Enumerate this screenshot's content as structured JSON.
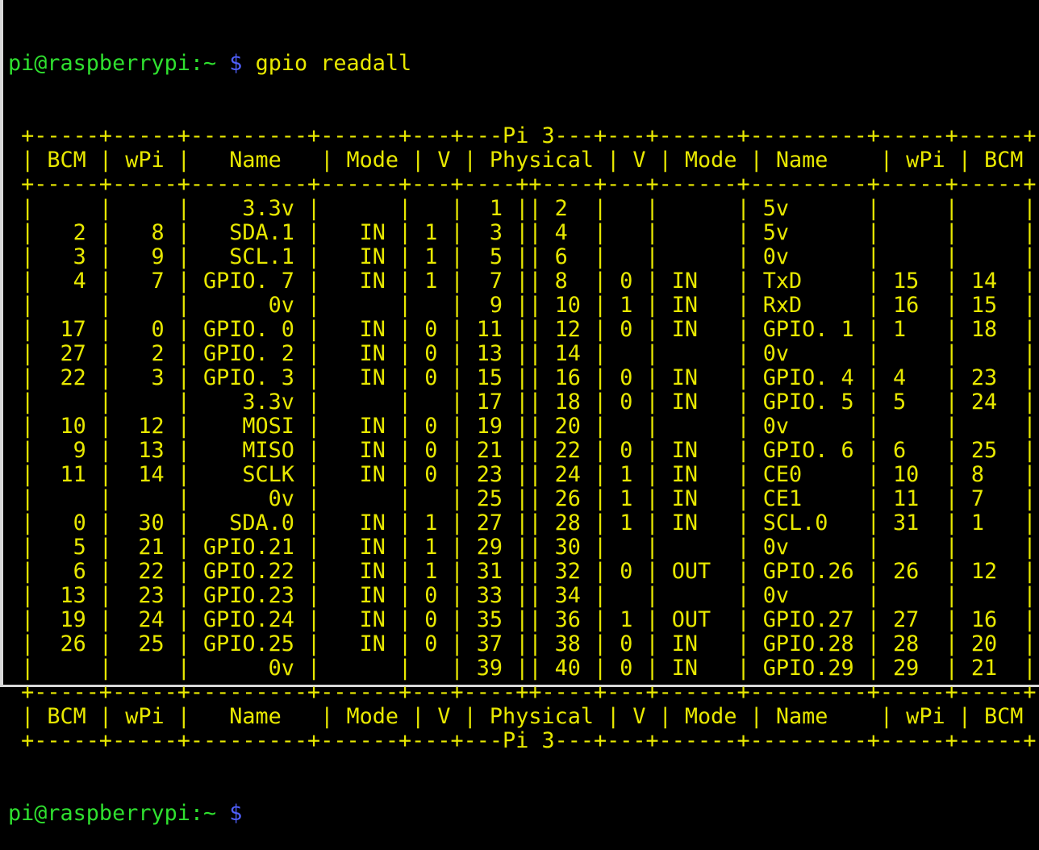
{
  "prompt": {
    "user_host": "pi@raspberrypi",
    "path": ":~",
    "symbol": "$"
  },
  "command": "gpio readall",
  "board_label": "Pi 3",
  "header": [
    "BCM",
    "wPi",
    "Name",
    "Mode",
    "V",
    "Physical",
    "V",
    "Mode",
    "Name",
    "wPi",
    "BCM"
  ],
  "rows": [
    {
      "bcm_l": "",
      "wpi_l": "",
      "name_l": "3.3v",
      "mode_l": "",
      "v_l": "",
      "phys_l": "1",
      "phys_r": "2",
      "v_r": "",
      "mode_r": "",
      "name_r": "5v",
      "wpi_r": "",
      "bcm_r": ""
    },
    {
      "bcm_l": "2",
      "wpi_l": "8",
      "name_l": "SDA.1",
      "mode_l": "IN",
      "v_l": "1",
      "phys_l": "3",
      "phys_r": "4",
      "v_r": "",
      "mode_r": "",
      "name_r": "5v",
      "wpi_r": "",
      "bcm_r": ""
    },
    {
      "bcm_l": "3",
      "wpi_l": "9",
      "name_l": "SCL.1",
      "mode_l": "IN",
      "v_l": "1",
      "phys_l": "5",
      "phys_r": "6",
      "v_r": "",
      "mode_r": "",
      "name_r": "0v",
      "wpi_r": "",
      "bcm_r": ""
    },
    {
      "bcm_l": "4",
      "wpi_l": "7",
      "name_l": "GPIO. 7",
      "mode_l": "IN",
      "v_l": "1",
      "phys_l": "7",
      "phys_r": "8",
      "v_r": "0",
      "mode_r": "IN",
      "name_r": "TxD",
      "wpi_r": "15",
      "bcm_r": "14"
    },
    {
      "bcm_l": "",
      "wpi_l": "",
      "name_l": "0v",
      "mode_l": "",
      "v_l": "",
      "phys_l": "9",
      "phys_r": "10",
      "v_r": "1",
      "mode_r": "IN",
      "name_r": "RxD",
      "wpi_r": "16",
      "bcm_r": "15"
    },
    {
      "bcm_l": "17",
      "wpi_l": "0",
      "name_l": "GPIO. 0",
      "mode_l": "IN",
      "v_l": "0",
      "phys_l": "11",
      "phys_r": "12",
      "v_r": "0",
      "mode_r": "IN",
      "name_r": "GPIO. 1",
      "wpi_r": "1",
      "bcm_r": "18"
    },
    {
      "bcm_l": "27",
      "wpi_l": "2",
      "name_l": "GPIO. 2",
      "mode_l": "IN",
      "v_l": "0",
      "phys_l": "13",
      "phys_r": "14",
      "v_r": "",
      "mode_r": "",
      "name_r": "0v",
      "wpi_r": "",
      "bcm_r": ""
    },
    {
      "bcm_l": "22",
      "wpi_l": "3",
      "name_l": "GPIO. 3",
      "mode_l": "IN",
      "v_l": "0",
      "phys_l": "15",
      "phys_r": "16",
      "v_r": "0",
      "mode_r": "IN",
      "name_r": "GPIO. 4",
      "wpi_r": "4",
      "bcm_r": "23"
    },
    {
      "bcm_l": "",
      "wpi_l": "",
      "name_l": "3.3v",
      "mode_l": "",
      "v_l": "",
      "phys_l": "17",
      "phys_r": "18",
      "v_r": "0",
      "mode_r": "IN",
      "name_r": "GPIO. 5",
      "wpi_r": "5",
      "bcm_r": "24"
    },
    {
      "bcm_l": "10",
      "wpi_l": "12",
      "name_l": "MOSI",
      "mode_l": "IN",
      "v_l": "0",
      "phys_l": "19",
      "phys_r": "20",
      "v_r": "",
      "mode_r": "",
      "name_r": "0v",
      "wpi_r": "",
      "bcm_r": ""
    },
    {
      "bcm_l": "9",
      "wpi_l": "13",
      "name_l": "MISO",
      "mode_l": "IN",
      "v_l": "0",
      "phys_l": "21",
      "phys_r": "22",
      "v_r": "0",
      "mode_r": "IN",
      "name_r": "GPIO. 6",
      "wpi_r": "6",
      "bcm_r": "25"
    },
    {
      "bcm_l": "11",
      "wpi_l": "14",
      "name_l": "SCLK",
      "mode_l": "IN",
      "v_l": "0",
      "phys_l": "23",
      "phys_r": "24",
      "v_r": "1",
      "mode_r": "IN",
      "name_r": "CE0",
      "wpi_r": "10",
      "bcm_r": "8"
    },
    {
      "bcm_l": "",
      "wpi_l": "",
      "name_l": "0v",
      "mode_l": "",
      "v_l": "",
      "phys_l": "25",
      "phys_r": "26",
      "v_r": "1",
      "mode_r": "IN",
      "name_r": "CE1",
      "wpi_r": "11",
      "bcm_r": "7"
    },
    {
      "bcm_l": "0",
      "wpi_l": "30",
      "name_l": "SDA.0",
      "mode_l": "IN",
      "v_l": "1",
      "phys_l": "27",
      "phys_r": "28",
      "v_r": "1",
      "mode_r": "IN",
      "name_r": "SCL.0",
      "wpi_r": "31",
      "bcm_r": "1"
    },
    {
      "bcm_l": "5",
      "wpi_l": "21",
      "name_l": "GPIO.21",
      "mode_l": "IN",
      "v_l": "1",
      "phys_l": "29",
      "phys_r": "30",
      "v_r": "",
      "mode_r": "",
      "name_r": "0v",
      "wpi_r": "",
      "bcm_r": ""
    },
    {
      "bcm_l": "6",
      "wpi_l": "22",
      "name_l": "GPIO.22",
      "mode_l": "IN",
      "v_l": "1",
      "phys_l": "31",
      "phys_r": "32",
      "v_r": "0",
      "mode_r": "OUT",
      "name_r": "GPIO.26",
      "wpi_r": "26",
      "bcm_r": "12"
    },
    {
      "bcm_l": "13",
      "wpi_l": "23",
      "name_l": "GPIO.23",
      "mode_l": "IN",
      "v_l": "0",
      "phys_l": "33",
      "phys_r": "34",
      "v_r": "",
      "mode_r": "",
      "name_r": "0v",
      "wpi_r": "",
      "bcm_r": ""
    },
    {
      "bcm_l": "19",
      "wpi_l": "24",
      "name_l": "GPIO.24",
      "mode_l": "IN",
      "v_l": "0",
      "phys_l": "35",
      "phys_r": "36",
      "v_r": "1",
      "mode_r": "OUT",
      "name_r": "GPIO.27",
      "wpi_r": "27",
      "bcm_r": "16"
    },
    {
      "bcm_l": "26",
      "wpi_l": "25",
      "name_l": "GPIO.25",
      "mode_l": "IN",
      "v_l": "0",
      "phys_l": "37",
      "phys_r": "38",
      "v_r": "0",
      "mode_r": "IN",
      "name_r": "GPIO.28",
      "wpi_r": "28",
      "bcm_r": "20"
    },
    {
      "bcm_l": "",
      "wpi_l": "",
      "name_l": "0v",
      "mode_l": "",
      "v_l": "",
      "phys_l": "39",
      "phys_r": "40",
      "v_r": "0",
      "mode_r": "IN",
      "name_r": "GPIO.29",
      "wpi_r": "29",
      "bcm_r": "21"
    }
  ]
}
